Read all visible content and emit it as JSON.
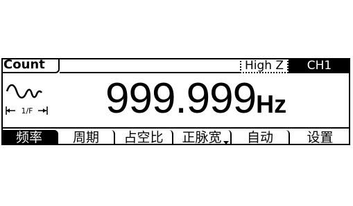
{
  "header": {
    "mode_title": "Count",
    "impedance": "High Z",
    "channel": "CH1"
  },
  "waveform": {
    "icon_name": "sine-wave-icon",
    "period_label": "1/F"
  },
  "readout": {
    "value": "999.999",
    "unit": "Hz"
  },
  "softkeys": [
    {
      "label": "频率",
      "selected": true
    },
    {
      "label": "周期",
      "selected": false
    },
    {
      "label": "占空比",
      "selected": false
    },
    {
      "label": "正脉宽",
      "selected": false,
      "has_submenu": true
    },
    {
      "label": "自动",
      "selected": false
    },
    {
      "label": "设置",
      "selected": false
    }
  ],
  "colors": {
    "foreground": "#000000",
    "background": "#ffffff"
  }
}
